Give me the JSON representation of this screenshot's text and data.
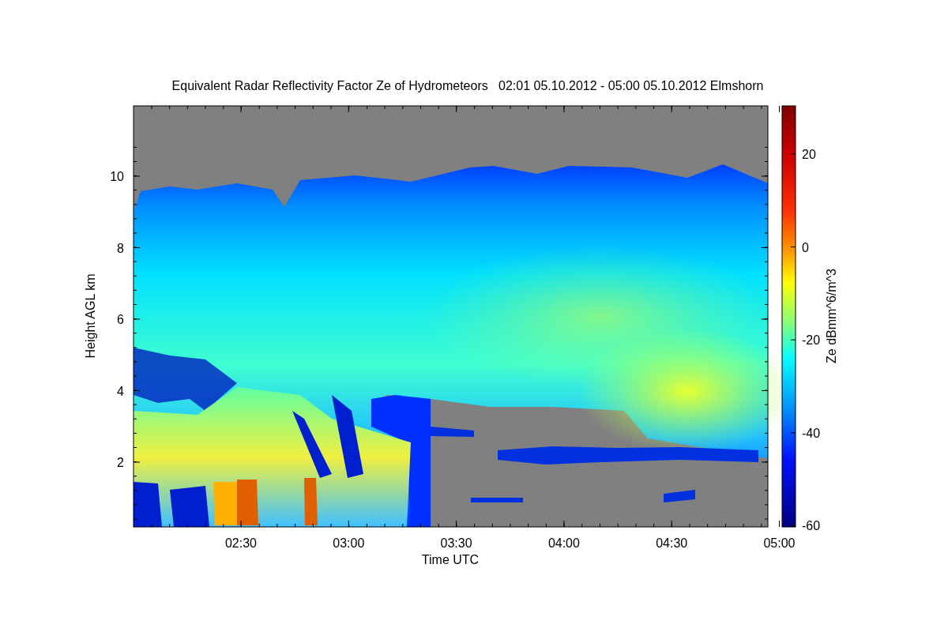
{
  "title": "Equivalent Radar Reflectivity Factor Ze of Hydrometeors   02:01 05.10.2012 - 05:00 05.10.2012 Elmshorn",
  "x_axis": {
    "label": "Time UTC",
    "ticks": [
      "02:30",
      "03:00",
      "03:30",
      "04:00",
      "04:30",
      "05:00"
    ]
  },
  "y_axis": {
    "label": "Height AGL km",
    "ticks": [
      "10",
      "8",
      "6",
      "4",
      "2"
    ]
  },
  "colorbar": {
    "label": "Ze dBmm^6/m^3",
    "ticks": [
      "20",
      "0",
      "-20",
      "-40",
      "-60"
    ]
  }
}
